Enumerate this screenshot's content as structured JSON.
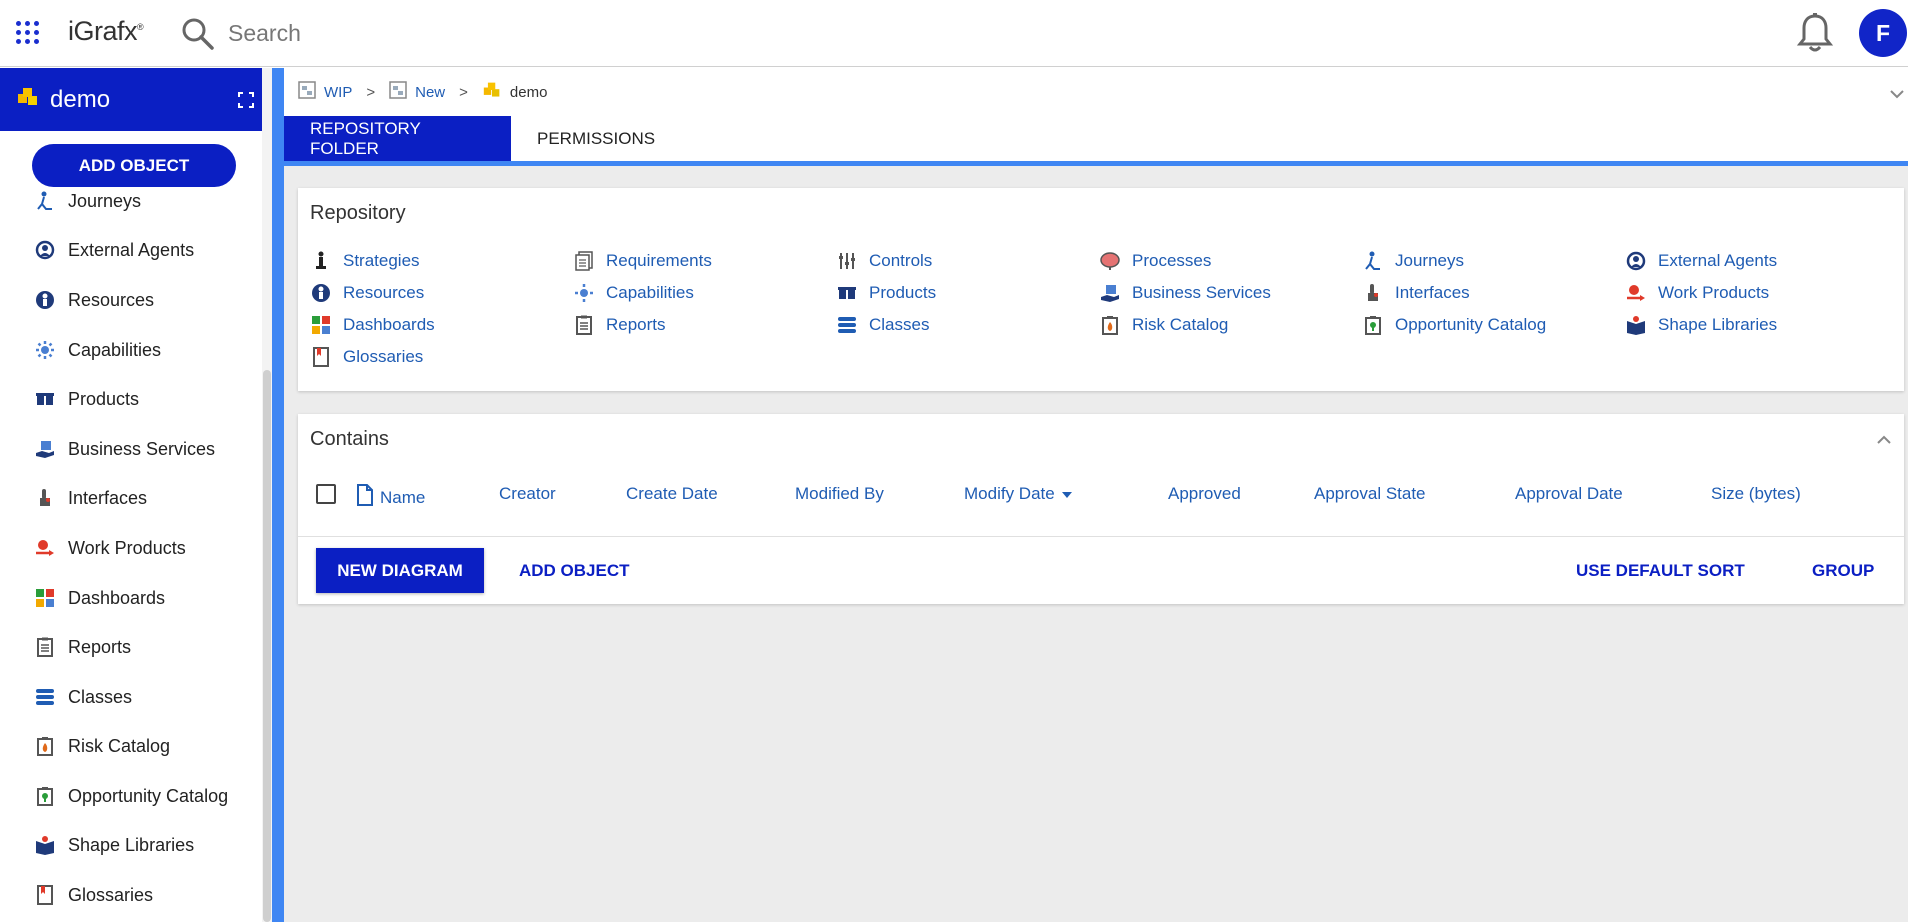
{
  "app": {
    "brand": "iGrafx",
    "brand_mark": "®",
    "avatar_initial": "F"
  },
  "search": {
    "placeholder": "Search"
  },
  "sidebar": {
    "title": "demo",
    "add_object": "ADD OBJECT",
    "items": [
      {
        "label": "Journeys",
        "icon": "journeys-icon"
      },
      {
        "label": "External Agents",
        "icon": "external-agents-icon"
      },
      {
        "label": "Resources",
        "icon": "resources-icon"
      },
      {
        "label": "Capabilities",
        "icon": "capabilities-icon"
      },
      {
        "label": "Products",
        "icon": "products-icon"
      },
      {
        "label": "Business Services",
        "icon": "business-services-icon"
      },
      {
        "label": "Interfaces",
        "icon": "interfaces-icon"
      },
      {
        "label": "Work Products",
        "icon": "work-products-icon"
      },
      {
        "label": "Dashboards",
        "icon": "dashboards-icon"
      },
      {
        "label": "Reports",
        "icon": "reports-icon"
      },
      {
        "label": "Classes",
        "icon": "classes-icon"
      },
      {
        "label": "Risk Catalog",
        "icon": "risk-catalog-icon"
      },
      {
        "label": "Opportunity Catalog",
        "icon": "opportunity-catalog-icon"
      },
      {
        "label": "Shape Libraries",
        "icon": "shape-libraries-icon"
      },
      {
        "label": "Glossaries",
        "icon": "glossaries-icon"
      }
    ]
  },
  "breadcrumb": {
    "items": [
      "WIP",
      "New"
    ],
    "separator": ">",
    "current": "demo"
  },
  "tabs": {
    "active": "REPOSITORY FOLDER",
    "other": "PERMISSIONS"
  },
  "repository": {
    "title": "Repository",
    "links": [
      "Strategies",
      "Requirements",
      "Controls",
      "Processes",
      "Journeys",
      "External Agents",
      "Resources",
      "Capabilities",
      "Products",
      "Business Services",
      "Interfaces",
      "Work Products",
      "Dashboards",
      "Reports",
      "Classes",
      "Risk Catalog",
      "Opportunity Catalog",
      "Shape Libraries",
      "Glossaries"
    ]
  },
  "contains": {
    "title": "Contains",
    "columns": [
      "Name",
      "Creator",
      "Create Date",
      "Modified By",
      "Modify Date",
      "Approved",
      "Approval State",
      "Approval Date",
      "Size (bytes)"
    ],
    "sorted_column": "Modify Date",
    "actions": {
      "new_diagram": "NEW DIAGRAM",
      "add_object": "ADD OBJECT",
      "use_default_sort": "USE DEFAULT SORT",
      "group": "GROUP"
    }
  },
  "colors": {
    "primary": "#0b1fc3",
    "accent": "#3f86f3",
    "link": "#1f5cb3"
  }
}
